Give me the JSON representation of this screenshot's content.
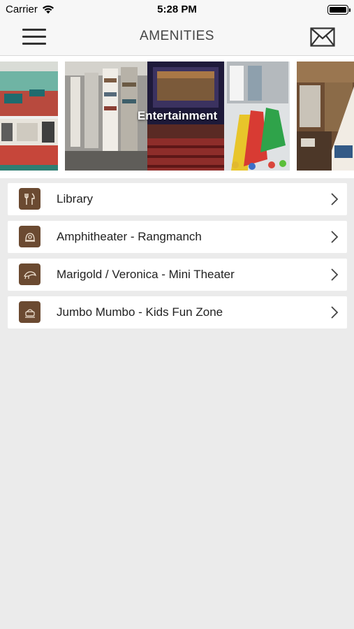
{
  "status_bar": {
    "carrier": "Carrier",
    "time": "5:28 PM"
  },
  "nav": {
    "title": "AMENITIES",
    "menu_icon": "hamburger-menu-icon",
    "mail_icon": "mail-icon"
  },
  "carousel": {
    "slides": [
      {
        "label": ""
      },
      {
        "label": "Entertainment"
      },
      {
        "label": ""
      }
    ]
  },
  "amenities": [
    {
      "label": "Library",
      "icon": "utensils-icon"
    },
    {
      "label": "Amphitheater - Rangmanch",
      "icon": "amphitheater-icon"
    },
    {
      "label": "Marigold / Veronica - Mini Theater",
      "icon": "theater-icon"
    },
    {
      "label": "Jumbo Mumbo - Kids Fun Zone",
      "icon": "kids-zone-icon"
    }
  ],
  "colors": {
    "icon_bg": "#6b4a31",
    "background": "#ebebeb",
    "bar_bg": "#f7f7f7"
  }
}
